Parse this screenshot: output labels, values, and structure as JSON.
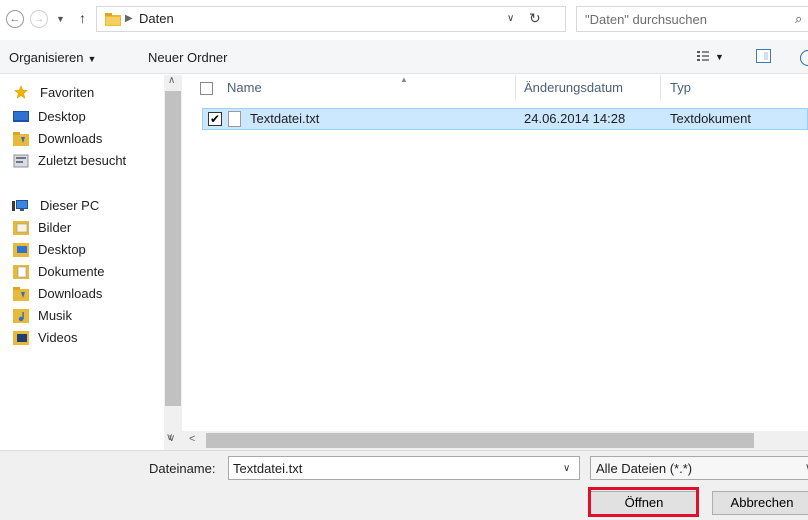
{
  "address_bar": {
    "path_segment": "Daten",
    "search_placeholder": "\"Daten\" durchsuchen"
  },
  "toolbar": {
    "organize_label": "Organisieren",
    "new_folder_label": "Neuer Ordner"
  },
  "nav_pane": {
    "favorites": {
      "label": "Favoriten",
      "items": [
        {
          "label": "Desktop",
          "icon": "desktop-icon"
        },
        {
          "label": "Downloads",
          "icon": "downloads-folder-icon"
        },
        {
          "label": "Zuletzt besucht",
          "icon": "recent-places-icon"
        }
      ]
    },
    "this_pc": {
      "label": "Dieser PC",
      "items": [
        {
          "label": "Bilder",
          "icon": "pictures-folder-icon"
        },
        {
          "label": "Desktop",
          "icon": "desktop-folder-icon"
        },
        {
          "label": "Dokumente",
          "icon": "documents-folder-icon"
        },
        {
          "label": "Downloads",
          "icon": "downloads-folder-icon"
        },
        {
          "label": "Musik",
          "icon": "music-folder-icon"
        },
        {
          "label": "Videos",
          "icon": "videos-folder-icon"
        }
      ]
    }
  },
  "file_list": {
    "columns": [
      "Name",
      "Änderungsdatum",
      "Typ"
    ],
    "rows": [
      {
        "name": "Textdatei.txt",
        "modified": "24.06.2014 14:28",
        "type": "Textdokument",
        "checked": true,
        "selected": true
      }
    ]
  },
  "bottom": {
    "filename_label": "Dateiname:",
    "filename_value": "Textdatei.txt",
    "file_type_value": "Alle Dateien (*.*)",
    "open_label": "Öffnen",
    "cancel_label": "Abbrechen"
  },
  "colors": {
    "selection_bg": "#cce8ff",
    "selection_border": "#99d1ff",
    "highlight": "#e0102b",
    "header_text": "#4c607a"
  }
}
